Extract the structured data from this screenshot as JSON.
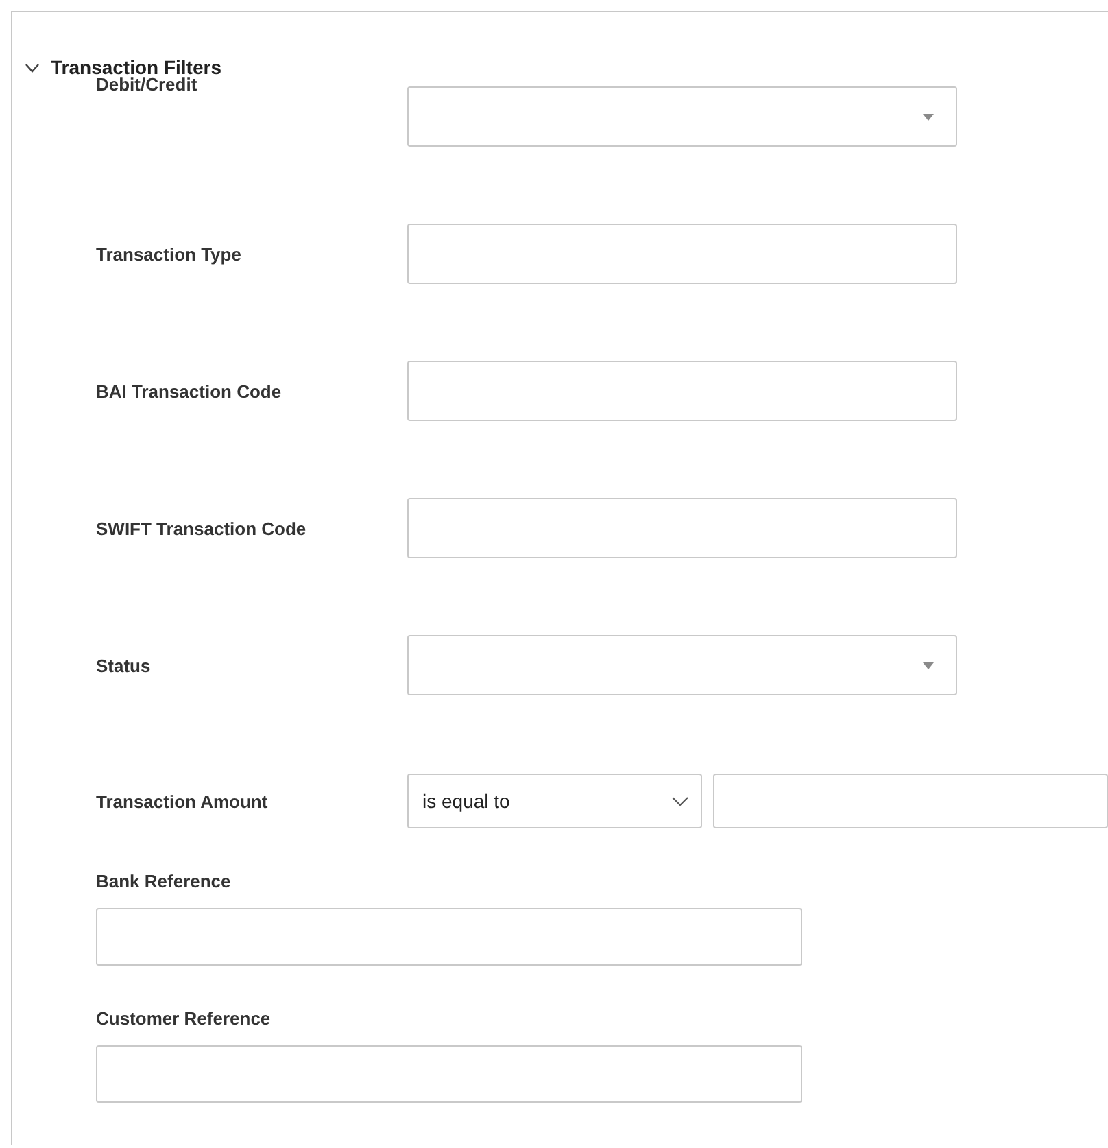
{
  "section": {
    "title": "Transaction Filters",
    "expanded": true
  },
  "fields": [
    {
      "label": "Debit/Credit",
      "kind": "dropdown"
    },
    {
      "label": "Transaction Type",
      "kind": "text"
    },
    {
      "label": "BAI Transaction Code",
      "kind": "text"
    },
    {
      "label": "SWIFT Transaction Code",
      "kind": "text"
    },
    {
      "label": "Status",
      "kind": "dropdown"
    },
    {
      "label": "Transaction Amount",
      "kind": "amount",
      "operator": "is equal to"
    },
    {
      "label": "Bank Reference",
      "kind": "stacked"
    },
    {
      "label": "Customer Reference",
      "kind": "stacked"
    }
  ]
}
